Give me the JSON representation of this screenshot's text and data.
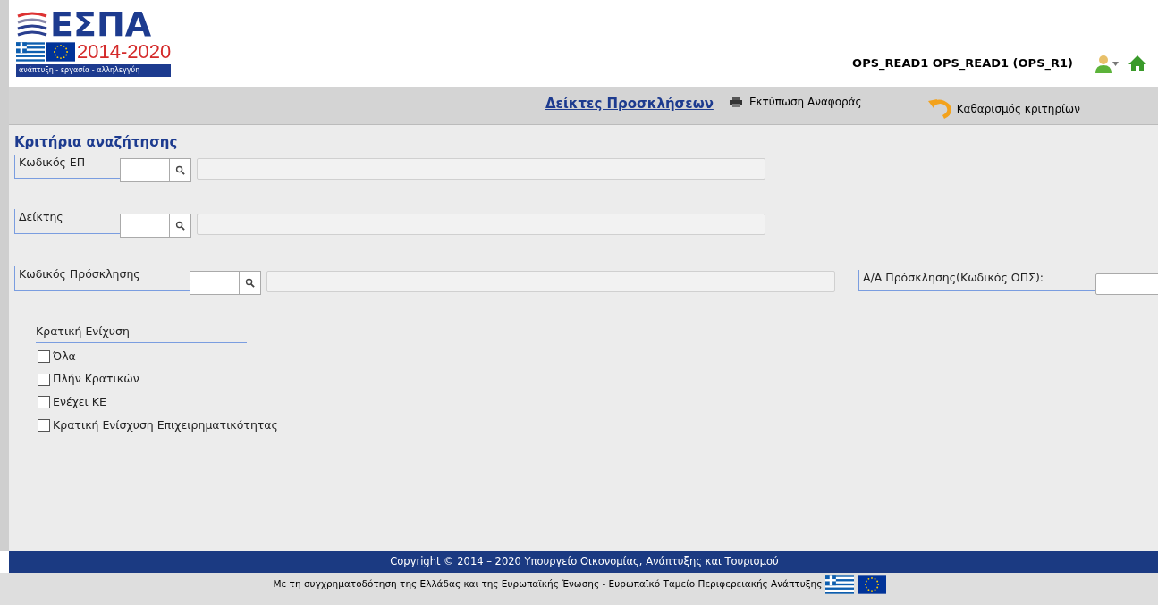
{
  "logo": {
    "title": "ΕΣΠΑ",
    "years": "2014-2020",
    "motto": "ανάπτυξη - εργασία - αλληλεγγύη"
  },
  "user": {
    "name": "OPS_READ1 OPS_READ1 (OPS_R1)"
  },
  "toolbar": {
    "page_title": "Δείκτες Προσκλήσεων",
    "print": "Εκτύπωση Αναφοράς",
    "clear": "Καθαρισμός κριτηρίων"
  },
  "search": {
    "heading": "Κριτήρια αναζήτησης",
    "fields": [
      {
        "label": "Κωδικός ΕΠ"
      },
      {
        "label": "Δείκτης"
      },
      {
        "label": "Κωδικός Πρόσκλησης"
      }
    ],
    "call_number": {
      "label": "Α/Α Πρόσκλησης(Κωδικός ΟΠΣ):"
    },
    "state_aid": {
      "label": "Κρατική Ενίχυση",
      "options": [
        {
          "label": "Όλα",
          "checked": false
        },
        {
          "label": "Πλήν Κρατικών",
          "checked": false
        },
        {
          "label": "Ενέχει ΚΕ",
          "checked": false
        },
        {
          "label": "Κρατική Ενίσχυση Επιχειρηματικότητας",
          "checked": false
        }
      ]
    }
  },
  "footer": {
    "copyright": "Copyright © 2014 – 2020 Υπουργείο Οικονομίας, Ανάπτυξης και Τουρισμού",
    "funding": "Με τη συγχρηματοδότηση της Ελλάδας και της Ευρωπαϊκής Ένωσης - Ευρωπαϊκό Ταμείο Περιφερειακής Ανάπτυξης"
  }
}
